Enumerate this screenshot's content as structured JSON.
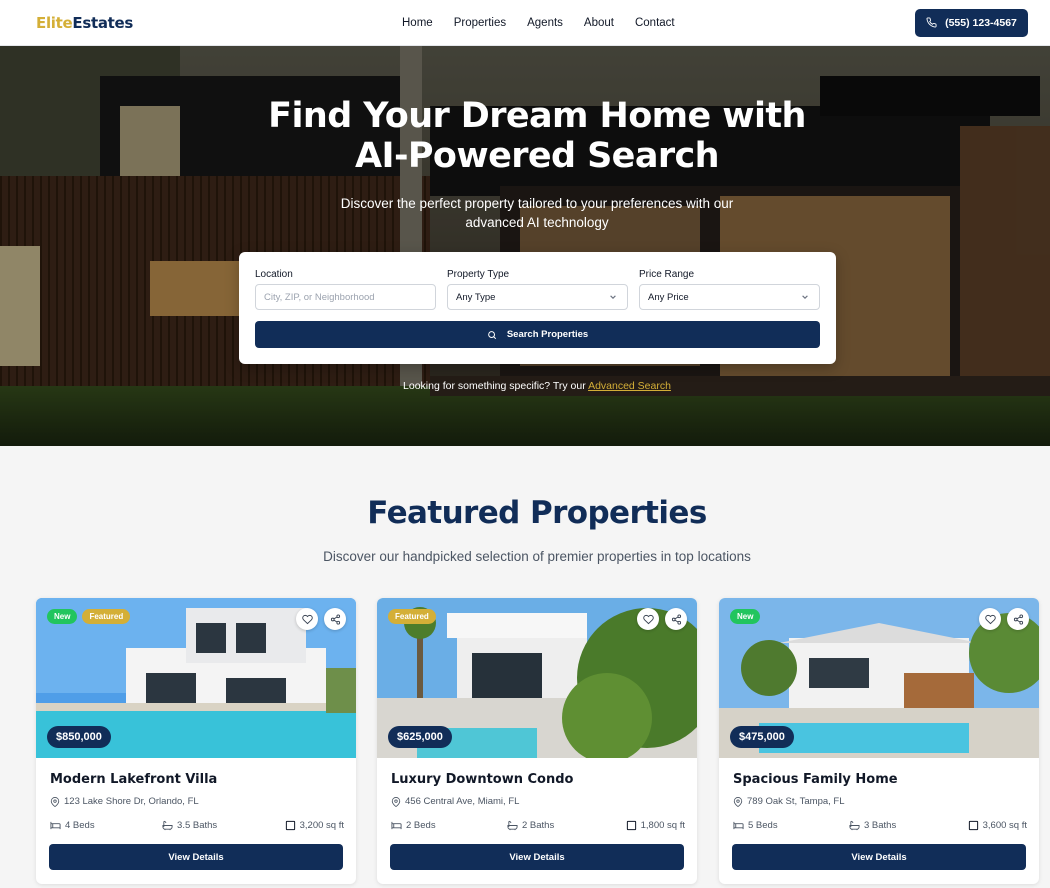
{
  "nav": {
    "logo_part1": "Elite",
    "logo_part2": "Estates",
    "links": [
      "Home",
      "Properties",
      "Agents",
      "About",
      "Contact"
    ],
    "phone": "(555) 123-4567"
  },
  "hero": {
    "title_line1": "Find Your Dream Home with",
    "title_line2": "AI-Powered Search",
    "subtitle_line1": "Discover the perfect property tailored to your preferences with our",
    "subtitle_line2": "advanced AI technology",
    "hint_prefix": "Looking for something specific? Try our",
    "hint_link": "Advanced Search"
  },
  "search": {
    "location_label": "Location",
    "location_placeholder": "City, ZIP, or Neighborhood",
    "type_label": "Property Type",
    "type_value": "Any Type",
    "price_label": "Price Range",
    "price_value": "Any Price",
    "button_label": "Search Properties"
  },
  "featured": {
    "title": "Featured Properties",
    "subtitle": "Discover our handpicked selection of premier properties in top locations",
    "properties": [
      {
        "badges": [
          "New",
          "Featured"
        ],
        "price": "$850,000",
        "title": "Modern Lakefront Villa",
        "address": "123 Lake Shore Dr, Orlando, FL",
        "beds": "4 Beds",
        "baths": "3.5 Baths",
        "sqft": "3,200 sq ft",
        "button": "View Details"
      },
      {
        "badges": [
          "Featured"
        ],
        "price": "$625,000",
        "title": "Luxury Downtown Condo",
        "address": "456 Central Ave, Miami, FL",
        "beds": "2 Beds",
        "baths": "2 Baths",
        "sqft": "1,800 sq ft",
        "button": "View Details"
      },
      {
        "badges": [
          "New"
        ],
        "price": "$475,000",
        "title": "Spacious Family Home",
        "address": "789 Oak St, Tampa, FL",
        "beds": "5 Beds",
        "baths": "3 Baths",
        "sqft": "3,600 sq ft",
        "button": "View Details"
      }
    ]
  },
  "colors": {
    "brand_navy": "#112d58",
    "brand_gold": "#d4af37",
    "badge_new": "#22c55e"
  },
  "icons": [
    "phone-icon",
    "search-icon",
    "chevron-down-icon",
    "heart-icon",
    "share-icon",
    "map-pin-icon",
    "bed-icon",
    "bath-icon",
    "area-icon"
  ]
}
